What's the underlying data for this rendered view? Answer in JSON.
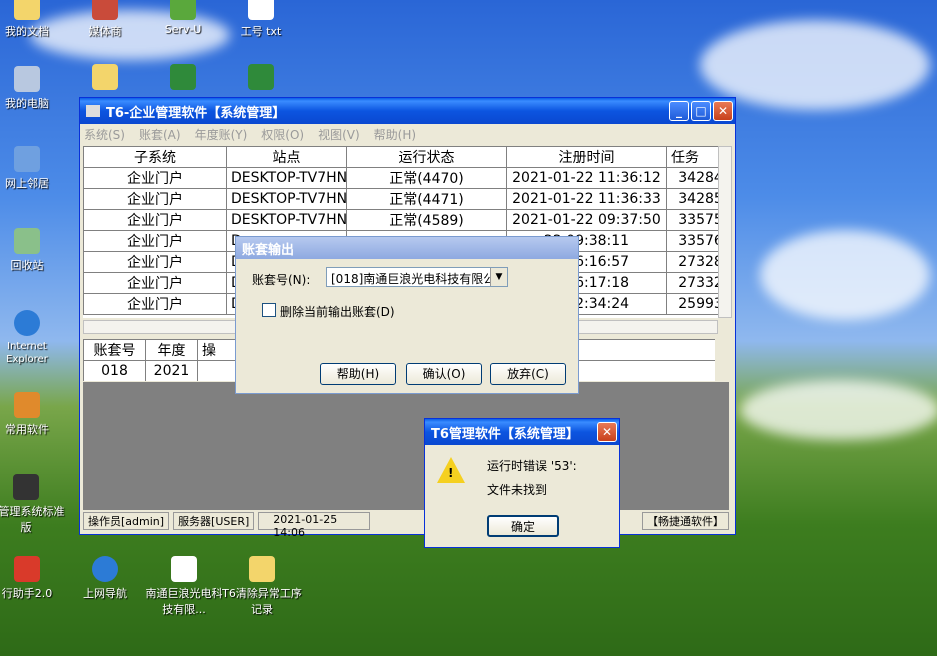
{
  "desktop": {
    "icons": [
      {
        "label": "我的文档"
      },
      {
        "label": "媒体商"
      },
      {
        "label": "Serv-U"
      },
      {
        "label": "工号 txt"
      },
      {
        "label": "我的电脑"
      },
      {
        "label": "网上邻居"
      },
      {
        "label": "回收站"
      },
      {
        "label": "Internet Explorer"
      },
      {
        "label": "常用软件"
      },
      {
        "label": "勤管理系统标准版"
      },
      {
        "label": "行助手2.0"
      },
      {
        "label": "上网导航"
      },
      {
        "label": "南通巨浪光电科技有限..."
      },
      {
        "label": "T6清除异常工序记录"
      }
    ]
  },
  "main_window": {
    "title": "T6-企业管理软件【系统管理】",
    "menu": [
      "系统(S)",
      "账套(A)",
      "年度账(Y)",
      "权限(O)",
      "视图(V)",
      "帮助(H)"
    ],
    "columns": [
      "子系统",
      "站点",
      "运行状态",
      "注册时间",
      "任务"
    ],
    "rows": [
      [
        "企业门户",
        "DESKTOP-TV7HN1F",
        "正常(4470)",
        "2021-01-22 11:36:12",
        "342845"
      ],
      [
        "企业门户",
        "DESKTOP-TV7HN1F",
        "正常(4471)",
        "2021-01-22 11:36:33",
        "342853"
      ],
      [
        "企业门户",
        "DESKTOP-TV7HN1F",
        "正常(4589)",
        "2021-01-22 09:37:50",
        "335757"
      ],
      [
        "企业门户",
        "D",
        "",
        "22 09:38:11",
        "335765"
      ],
      [
        "企业门户",
        "D",
        "",
        "21 16:16:57",
        "273285"
      ],
      [
        "企业门户",
        "D",
        "",
        "21 16:17:18",
        "273320"
      ],
      [
        "企业门户",
        "D",
        "",
        "21 12:34:24",
        "259932"
      ]
    ],
    "lower_columns": [
      "账套号",
      "年度",
      "操"
    ],
    "lower_rows": [
      [
        "018",
        "2021",
        ""
      ]
    ],
    "status": {
      "operator": "操作员[admin]",
      "server": "服务器[USER]",
      "datetime": "2021-01-25 14:06",
      "brand": "【畅捷通软件】"
    }
  },
  "export_dialog": {
    "title": "账套输出",
    "account_label": "账套号(N):",
    "account_value": "[018]南通巨浪光电科技有限公",
    "delete_label": "删除当前输出账套(D)",
    "help_btn": "帮助(H)",
    "ok_btn": "确认(O)",
    "cancel_btn": "放弃(C)"
  },
  "error_dialog": {
    "title": "T6管理软件【系统管理】",
    "line1": "运行时错误 '53':",
    "line2": "文件未找到",
    "ok_btn": "确定"
  }
}
